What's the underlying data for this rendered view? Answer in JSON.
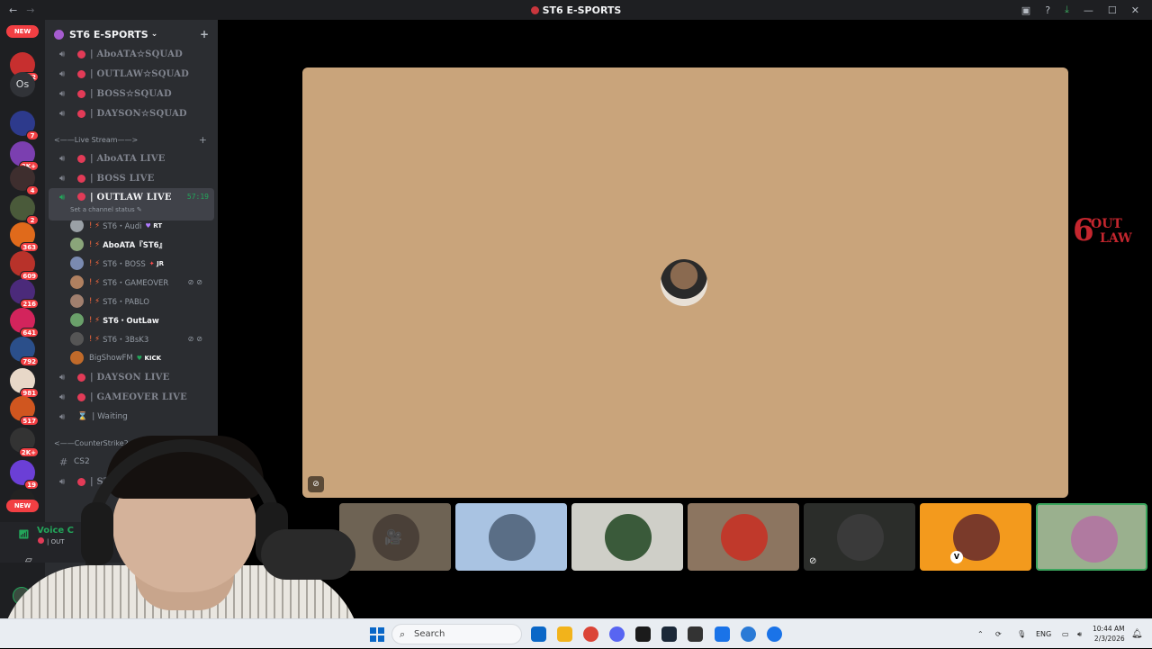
{
  "window": {
    "title": "ST6 E-SPORTS"
  },
  "servers": {
    "new_top": "NEW",
    "new_bottom": "NEW",
    "os_label": "Os",
    "items": [
      {
        "badge": "372",
        "color": "#c72f2f"
      },
      {
        "badge": "",
        "color": "#313338"
      },
      {
        "badge": "7",
        "color": "#2d3a8c"
      },
      {
        "badge": "2K+",
        "color": "#7b3fb0"
      },
      {
        "badge": "4",
        "color": "#3e2e2e"
      },
      {
        "badge": "2",
        "color": "#4a5a3a"
      },
      {
        "badge": "363",
        "color": "#e06a1b"
      },
      {
        "badge": "609",
        "color": "#b8322a"
      },
      {
        "badge": "216",
        "color": "#4b2a7a"
      },
      {
        "badge": "641",
        "color": "#d3245c"
      },
      {
        "badge": "792",
        "color": "#2b4f8a"
      },
      {
        "badge": "981",
        "color": "#e8d8c8"
      },
      {
        "badge": "517",
        "color": "#d0561f"
      },
      {
        "badge": "2K+",
        "color": "#333333"
      },
      {
        "badge": "19",
        "color": "#6b3fd6"
      },
      {
        "badge": "",
        "color": "#222222"
      }
    ],
    "last_label": "5з"
  },
  "sidebar": {
    "server_name": "ST6 E-SPORTS",
    "top_channels": [
      "| AboATA☆SQUAD",
      "| OUTLAW☆SQUAD",
      "| BOSS☆SQUAD",
      "| DAYSON☆SQUAD"
    ],
    "live_category": "<——Live Stream——>",
    "live_channels": [
      "| AboATA LIVE",
      "| BOSS LIVE"
    ],
    "active_channel": {
      "name": "| OUTLAW LIVE",
      "timer": "57:19",
      "status": "Set a channel status"
    },
    "voice_users": [
      {
        "prefix": "! ⚡",
        "name": "ST6・Audi",
        "tag": "RT",
        "tag_type": "heart",
        "bright": false,
        "muted": false,
        "av": "#9aa0a6"
      },
      {
        "prefix": "! ⚡",
        "name": "AboATA『ST6』",
        "tag": "",
        "tag_type": "",
        "bright": true,
        "muted": false,
        "av": "#8aa57a"
      },
      {
        "prefix": "! ⚡",
        "name": "ST6・BOSS",
        "tag": "JR",
        "tag_type": "flame",
        "bright": false,
        "muted": false,
        "av": "#7a8ab0"
      },
      {
        "prefix": "! ⚡",
        "name": "ST6・GAMEOVER",
        "tag": "",
        "tag_type": "",
        "bright": false,
        "muted": true,
        "av": "#b08060"
      },
      {
        "prefix": "! ⚡",
        "name": "ST6・PABLO",
        "tag": "",
        "tag_type": "",
        "bright": false,
        "muted": false,
        "av": "#a07f6e"
      },
      {
        "prefix": "! ⚡",
        "name": "ST6・OutLaw",
        "tag": "",
        "tag_type": "",
        "bright": true,
        "muted": false,
        "av": "#6aa06a"
      },
      {
        "prefix": "! ⚡",
        "name": "ST6・3BsK3",
        "tag": "",
        "tag_type": "",
        "bright": false,
        "muted": true,
        "av": "#555555"
      },
      {
        "prefix": "",
        "name": "BigShowFM",
        "tag": "KICK",
        "tag_type": "kick",
        "bright": false,
        "muted": false,
        "av": "#c06a2a"
      }
    ],
    "more_channels": [
      "| DAYSON LIVE",
      "| GAMEOVER LIVE"
    ],
    "waiting": "| Waiting",
    "cs_category": "<——CounterStrike2——>",
    "cs_text_channel": "CS2",
    "cs_voice_channel": "| ST6"
  },
  "voice_panel": {
    "title": "Voice C",
    "channel": "| OUT"
  },
  "stage": {
    "logo_line1": "6",
    "logo_line2": "OUT",
    "logo_line3": "LAW",
    "tiles": [
      {
        "bg": "#2f3a33",
        "av": "#6a6a5a",
        "selected": true,
        "icon": "",
        "badge": ""
      },
      {
        "bg": "#6e6354",
        "av": "#4a4038",
        "selected": false,
        "icon": "🎥",
        "badge": ""
      },
      {
        "bg": "#a9c3e2",
        "av": "#5a6e86",
        "selected": false,
        "icon": "",
        "badge": ""
      },
      {
        "bg": "#cfcfc8",
        "av": "#3a5a3a",
        "selected": false,
        "icon": "",
        "badge": ""
      },
      {
        "bg": "#8c7560",
        "av": "#c0392b",
        "selected": false,
        "icon": "",
        "badge": ""
      },
      {
        "bg": "#2b2d2a",
        "av": "#3a3a3a",
        "selected": false,
        "icon": "⊘",
        "badge": ""
      },
      {
        "bg": "#f39a1d",
        "av": "#7a3a2a",
        "selected": false,
        "icon": "",
        "badge": "V"
      },
      {
        "bg": "#9ab08e",
        "av": "#b07aa0",
        "selected": true,
        "icon": "",
        "badge": ""
      }
    ]
  },
  "taskbar": {
    "search_label": "Search",
    "apps": [
      "#0a67c7",
      "#f2b31b",
      "#db4437",
      "#5865f2",
      "#1b1b1b",
      "#1b2838",
      "#333333",
      "#1a73e8",
      "#2a7ad6",
      "#1a73e8"
    ],
    "lang": "ENG",
    "time": "10:44 AM",
    "date": "2/3/2026"
  }
}
